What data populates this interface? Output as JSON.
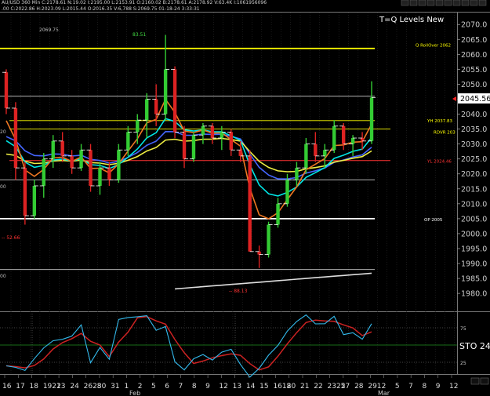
{
  "header": {
    "ohlc_line_1": "AU/USD 360 Min C:2178.61 N:19.02 I:2195.00 L:2153.91 O:2160.02 B:2178.61 A:2178.92 V:63.4K I:1061956096",
    "ohlc_line_2": ".00 C:2022.86 H:2023.09 L:2015.44 O:2016.35 V:6,788 S:2069.75 01-18-24 3:33:31"
  },
  "chart_data": [
    {
      "type": "candlestick",
      "title": "T=Q Levels New",
      "y_axis_side": "right",
      "ylim": [
        1974,
        2074
      ],
      "y_ticks": [
        1980,
        1985,
        1990,
        1995,
        2000,
        2005,
        2010,
        2015,
        2020,
        2025,
        2030,
        2035,
        2040,
        2045,
        2050,
        2055,
        2060,
        2065,
        2070
      ],
      "current_price_label": "2045.56",
      "current_price": 2045.56,
      "candles": [
        [
          2054.0,
          2055.0,
          2040.0,
          2042.0
        ],
        [
          2042.0,
          2044.0,
          2018.0,
          2022.0
        ],
        [
          2022.0,
          2024.0,
          2003.0,
          2006.0
        ],
        [
          2006.0,
          2018.0,
          2005.0,
          2016.0
        ],
        [
          2016.0,
          2027.0,
          2012.0,
          2025.0
        ],
        [
          2025.0,
          2033.0,
          2022.0,
          2031.0
        ],
        [
          2031.0,
          2034.0,
          2024.0,
          2026.0
        ],
        [
          2026.0,
          2028.0,
          2020.0,
          2022.0
        ],
        [
          2022.0,
          2030.0,
          2021.0,
          2028.0
        ],
        [
          2028.0,
          2030.0,
          2014.0,
          2016.0
        ],
        [
          2016.0,
          2024.0,
          2013.0,
          2022.0
        ],
        [
          2022.0,
          2024.0,
          2016.0,
          2018.0
        ],
        [
          2018.0,
          2030.0,
          2017.0,
          2028.0
        ],
        [
          2028.0,
          2036.0,
          2026.0,
          2034.0
        ],
        [
          2034.0,
          2040.0,
          2030.0,
          2038.0
        ],
        [
          2038.0,
          2047.0,
          2032.0,
          2045.0
        ],
        [
          2045.0,
          2050.0,
          2036.0,
          2040.0
        ],
        [
          2040.0,
          2066.5,
          2038.0,
          2055.0
        ],
        [
          2055.0,
          2056.0,
          2032.0,
          2034.0
        ],
        [
          2034.0,
          2036.0,
          2022.0,
          2025.0
        ],
        [
          2025.0,
          2034.0,
          2024.0,
          2033.0
        ],
        [
          2033.0,
          2037.0,
          2030.0,
          2036.0
        ],
        [
          2036.0,
          2037.0,
          2030.0,
          2032.0
        ],
        [
          2032.0,
          2036.0,
          2028.0,
          2034.0
        ],
        [
          2034.0,
          2035.0,
          2026.0,
          2028.0
        ],
        [
          2028.0,
          2031.0,
          2024.0,
          2026.0
        ],
        [
          2026.0,
          2028.0,
          1996.0,
          1994.0
        ],
        [
          1994.0,
          1996.0,
          1988.5,
          1993.0
        ],
        [
          1993.0,
          2004.0,
          1992.0,
          2003.0
        ],
        [
          2003.0,
          2012.0,
          2002.0,
          2010.0
        ],
        [
          2010.0,
          2020.0,
          2009.0,
          2018.0
        ],
        [
          2018.0,
          2024.0,
          2016.0,
          2022.0
        ],
        [
          2022.0,
          2032.0,
          2020.0,
          2030.0
        ],
        [
          2030.0,
          2034.0,
          2024.0,
          2026.0
        ],
        [
          2026.0,
          2030.0,
          2022.0,
          2028.0
        ],
        [
          2028.0,
          2038.0,
          2027.0,
          2036.0
        ],
        [
          2036.0,
          2037.0,
          2028.0,
          2030.0
        ],
        [
          2030.0,
          2033.0,
          2026.0,
          2032.0
        ],
        [
          2032.0,
          2034.0,
          2028.0,
          2031.0
        ],
        [
          2031.0,
          2051.0,
          2030.0,
          2045.56
        ]
      ],
      "levels": [
        {
          "name": "Q RollOver",
          "value": 2062,
          "color": "#ffff00",
          "label": "Q RollOver 2062"
        },
        {
          "name": "YH",
          "value": 2037.83,
          "color": "#ffff00",
          "label": "YH 2037.83"
        },
        {
          "name": "RDVR",
          "value": 2035,
          "color": "#ffff00",
          "label": "RDVR 203"
        },
        {
          "name": "YL",
          "value": 2024.46,
          "color": "#ff3333",
          "label": "YL 2024.46"
        },
        {
          "name": "OP",
          "value": 2005,
          "color": "#ffffff",
          "label": "OP 2005"
        },
        {
          "name": "line_2046",
          "value": 2046,
          "color": "#cccccc",
          "label": ""
        },
        {
          "name": "line_2018",
          "value": 2018,
          "color": "#cccccc",
          "label": ""
        },
        {
          "name": "line_1988",
          "value": 1988,
          "color": "#cccccc",
          "label": ""
        }
      ],
      "annotations": [
        {
          "text": "2069.75",
          "color": "#bbbbbb"
        },
        {
          "text": "83.51",
          "color": "#44dd44"
        },
        {
          "text": "-- 52.66",
          "color": "#ff3333"
        },
        {
          "text": "-- 88.13",
          "color": "#ff3333"
        }
      ],
      "left_axis_labels": [
        "20",
        "00",
        "00"
      ],
      "x_tick_labels": [
        "16",
        "17",
        "18",
        "1921",
        "23",
        "24",
        "2628",
        "30",
        "31",
        "1",
        "2",
        "5",
        "6",
        "7",
        "8",
        "9",
        "12",
        "13",
        "14",
        "15",
        "1618",
        "20",
        "21",
        "22",
        "2325",
        "27",
        "28",
        "291",
        "2",
        "5",
        "7",
        "8",
        "9",
        "12"
      ],
      "month_labels": [
        "Feb",
        "Mar"
      ],
      "series_colors": {
        "blue": "#4466ff",
        "yellow": "#eeee44",
        "orange": "#ee7722",
        "cyan": "#00e5e5",
        "white": "#dddddd"
      }
    },
    {
      "type": "line",
      "title": "STO",
      "label": "STO 24",
      "ylim": [
        0,
        100
      ],
      "y_ticks": [
        25,
        75
      ],
      "levels": [
        {
          "value": 75,
          "color": "#888888"
        },
        {
          "value": 25,
          "color": "#888888"
        }
      ],
      "series_colors": {
        "k": "#33bbee",
        "d": "#cc2222"
      }
    }
  ]
}
